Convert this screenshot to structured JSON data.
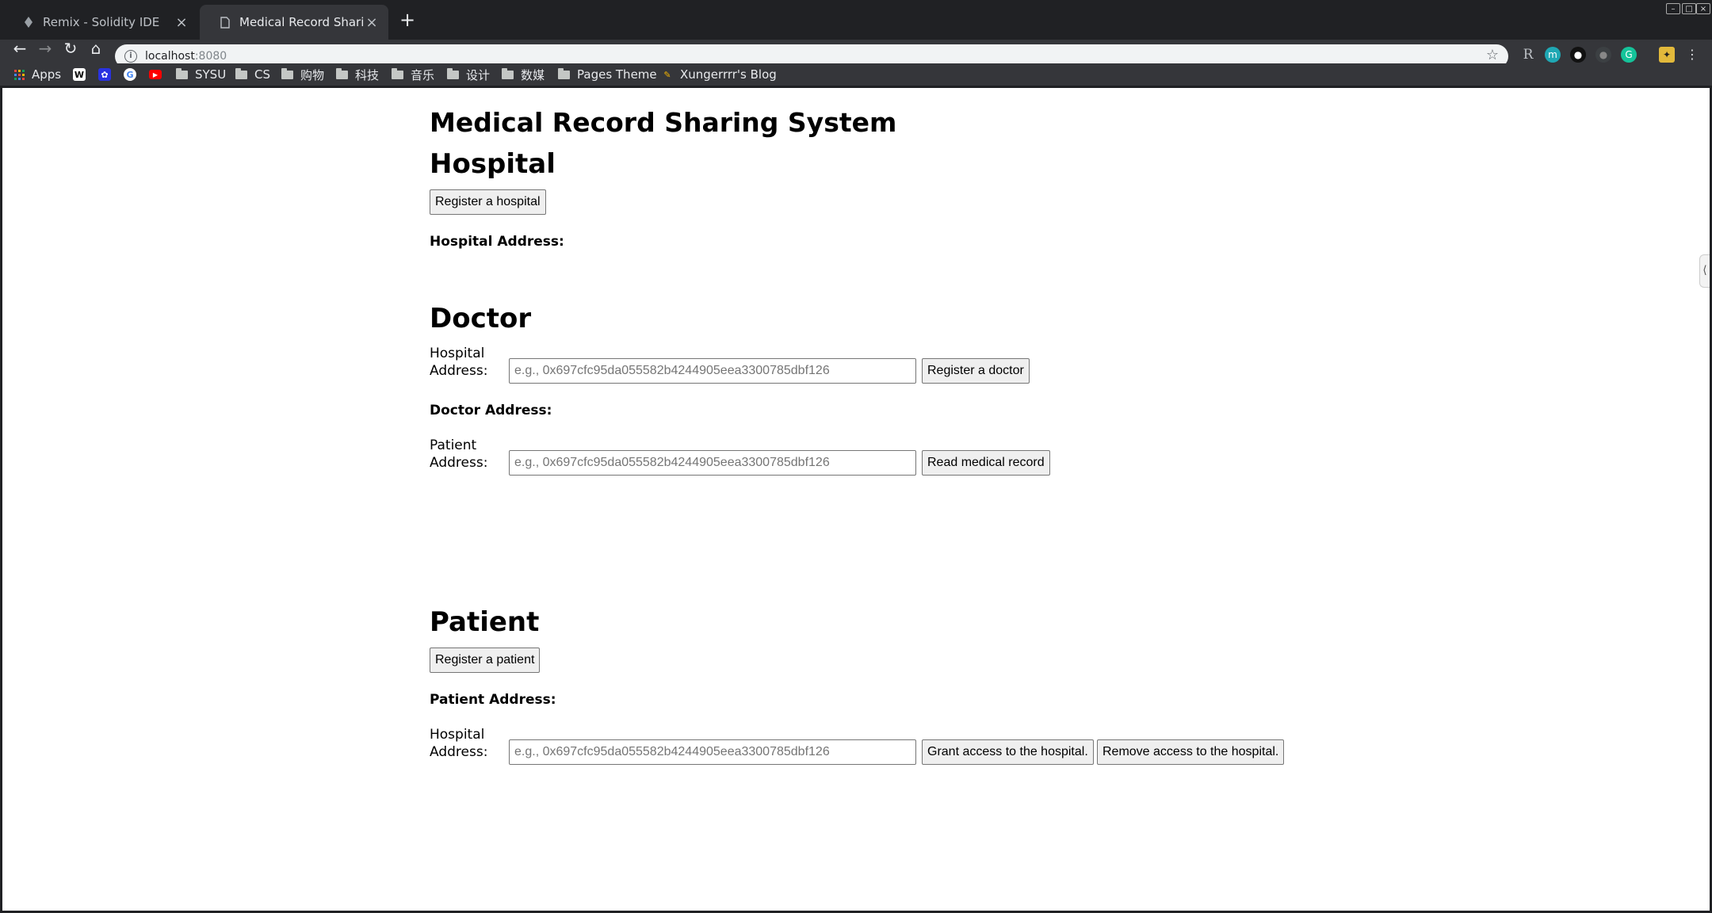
{
  "browser": {
    "tabs": [
      {
        "title": "Remix - Solidity IDE",
        "active": false
      },
      {
        "title": "Medical Record Sharing System",
        "active": true
      }
    ],
    "url_host": "localhost",
    "url_port": ":8080",
    "extensions": [
      "R",
      "m",
      "ext-dark",
      "ext-dark2",
      "G",
      "ext-bee"
    ],
    "bookmarks": [
      {
        "label": "Apps",
        "icon": "apps-grid-icon"
      },
      {
        "label": "",
        "icon": "wiki-icon"
      },
      {
        "label": "",
        "icon": "baidu-icon"
      },
      {
        "label": "",
        "icon": "google-icon"
      },
      {
        "label": "",
        "icon": "youtube-icon"
      },
      {
        "label": "SYSU",
        "icon": "folder-icon"
      },
      {
        "label": "CS",
        "icon": "folder-icon"
      },
      {
        "label": "购物",
        "icon": "folder-icon"
      },
      {
        "label": "科技",
        "icon": "folder-icon"
      },
      {
        "label": "音乐",
        "icon": "folder-icon"
      },
      {
        "label": "设计",
        "icon": "folder-icon"
      },
      {
        "label": "数媒",
        "icon": "folder-icon"
      },
      {
        "label": "Pages Theme",
        "icon": "folder-icon"
      },
      {
        "label": "Xungerrrr's Blog",
        "icon": "blog-icon"
      }
    ]
  },
  "page": {
    "title": "Medical Record Sharing System",
    "hospital": {
      "heading": "Hospital",
      "register_button": "Register a hospital",
      "address_label": "Hospital Address:"
    },
    "doctor": {
      "heading": "Doctor",
      "hospital_address_label": "Hospital Address:",
      "hospital_address_placeholder": "e.g., 0x697cfc95da055582b4244905eea3300785dbf126",
      "register_button": "Register a doctor",
      "address_label": "Doctor Address:",
      "patient_address_label": "Patient Address:",
      "patient_address_placeholder": "e.g., 0x697cfc95da055582b4244905eea3300785dbf126",
      "read_button": "Read medical record"
    },
    "patient": {
      "heading": "Patient",
      "register_button": "Register a patient",
      "address_label": "Patient Address:",
      "hospital_address_label": "Hospital Address:",
      "hospital_address_placeholder": "e.g., 0x697cfc95da055582b4244905eea3300785dbf126",
      "grant_button": "Grant access to the hospital.",
      "remove_button": "Remove access to the hospital."
    }
  },
  "colors": {
    "chrome_dark": "#202124",
    "toolbar": "#35363a",
    "omnibox": "#f1f3f4",
    "button_bg": "#efefef"
  }
}
